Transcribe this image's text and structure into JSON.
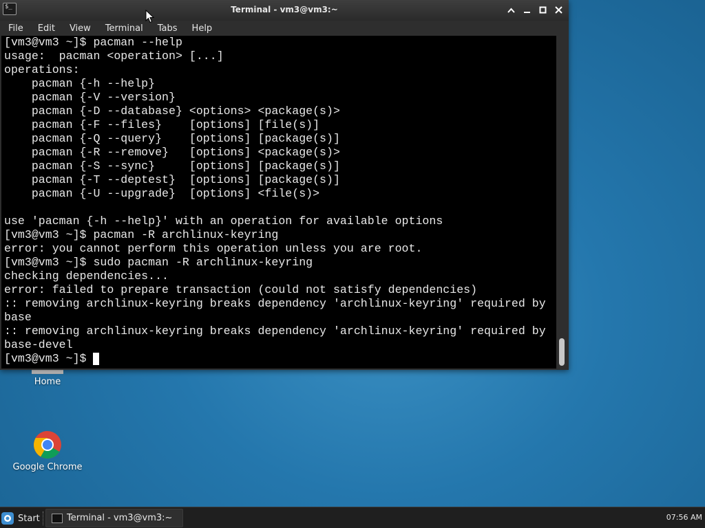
{
  "window": {
    "title": "Terminal - vm3@vm3:~",
    "icon_text": "$_",
    "controls": {
      "up": "chevron-up-icon",
      "minimize": "minimize-icon",
      "maximize": "maximize-icon",
      "close": "close-icon"
    },
    "menu": [
      "File",
      "Edit",
      "View",
      "Terminal",
      "Tabs",
      "Help"
    ]
  },
  "terminal": {
    "lines": [
      "[vm3@vm3 ~]$ pacman --help",
      "usage:  pacman <operation> [...]",
      "operations:",
      "    pacman {-h --help}",
      "    pacman {-V --version}",
      "    pacman {-D --database} <options> <package(s)>",
      "    pacman {-F --files}    [options] [file(s)]",
      "    pacman {-Q --query}    [options] [package(s)]",
      "    pacman {-R --remove}   [options] <package(s)>",
      "    pacman {-S --sync}     [options] [package(s)]",
      "    pacman {-T --deptest}  [options] [package(s)]",
      "    pacman {-U --upgrade}  [options] <file(s)>",
      "",
      "use 'pacman {-h --help}' with an operation for available options",
      "[vm3@vm3 ~]$ pacman -R archlinux-keyring",
      "error: you cannot perform this operation unless you are root.",
      "[vm3@vm3 ~]$ sudo pacman -R archlinux-keyring",
      "checking dependencies...",
      "error: failed to prepare transaction (could not satisfy dependencies)",
      ":: removing archlinux-keyring breaks dependency 'archlinux-keyring' required by",
      "base",
      ":: removing archlinux-keyring breaks dependency 'archlinux-keyring' required by",
      "base-devel"
    ],
    "prompt": "[vm3@vm3 ~]$ "
  },
  "desktop": {
    "icons": [
      {
        "label": "Home",
        "icon": "home-folder-icon"
      },
      {
        "label": "Google Chrome",
        "icon": "chrome-icon"
      }
    ]
  },
  "taskbar": {
    "start_label": "Start",
    "task_label": "Terminal - vm3@vm3:~",
    "clock": "07:56 AM"
  },
  "colors": {
    "terminal_bg": "#000000",
    "terminal_fg": "#e8e8e8",
    "desktop_bg": "#2477ad",
    "chrome_bar": "#2e2e2e"
  }
}
